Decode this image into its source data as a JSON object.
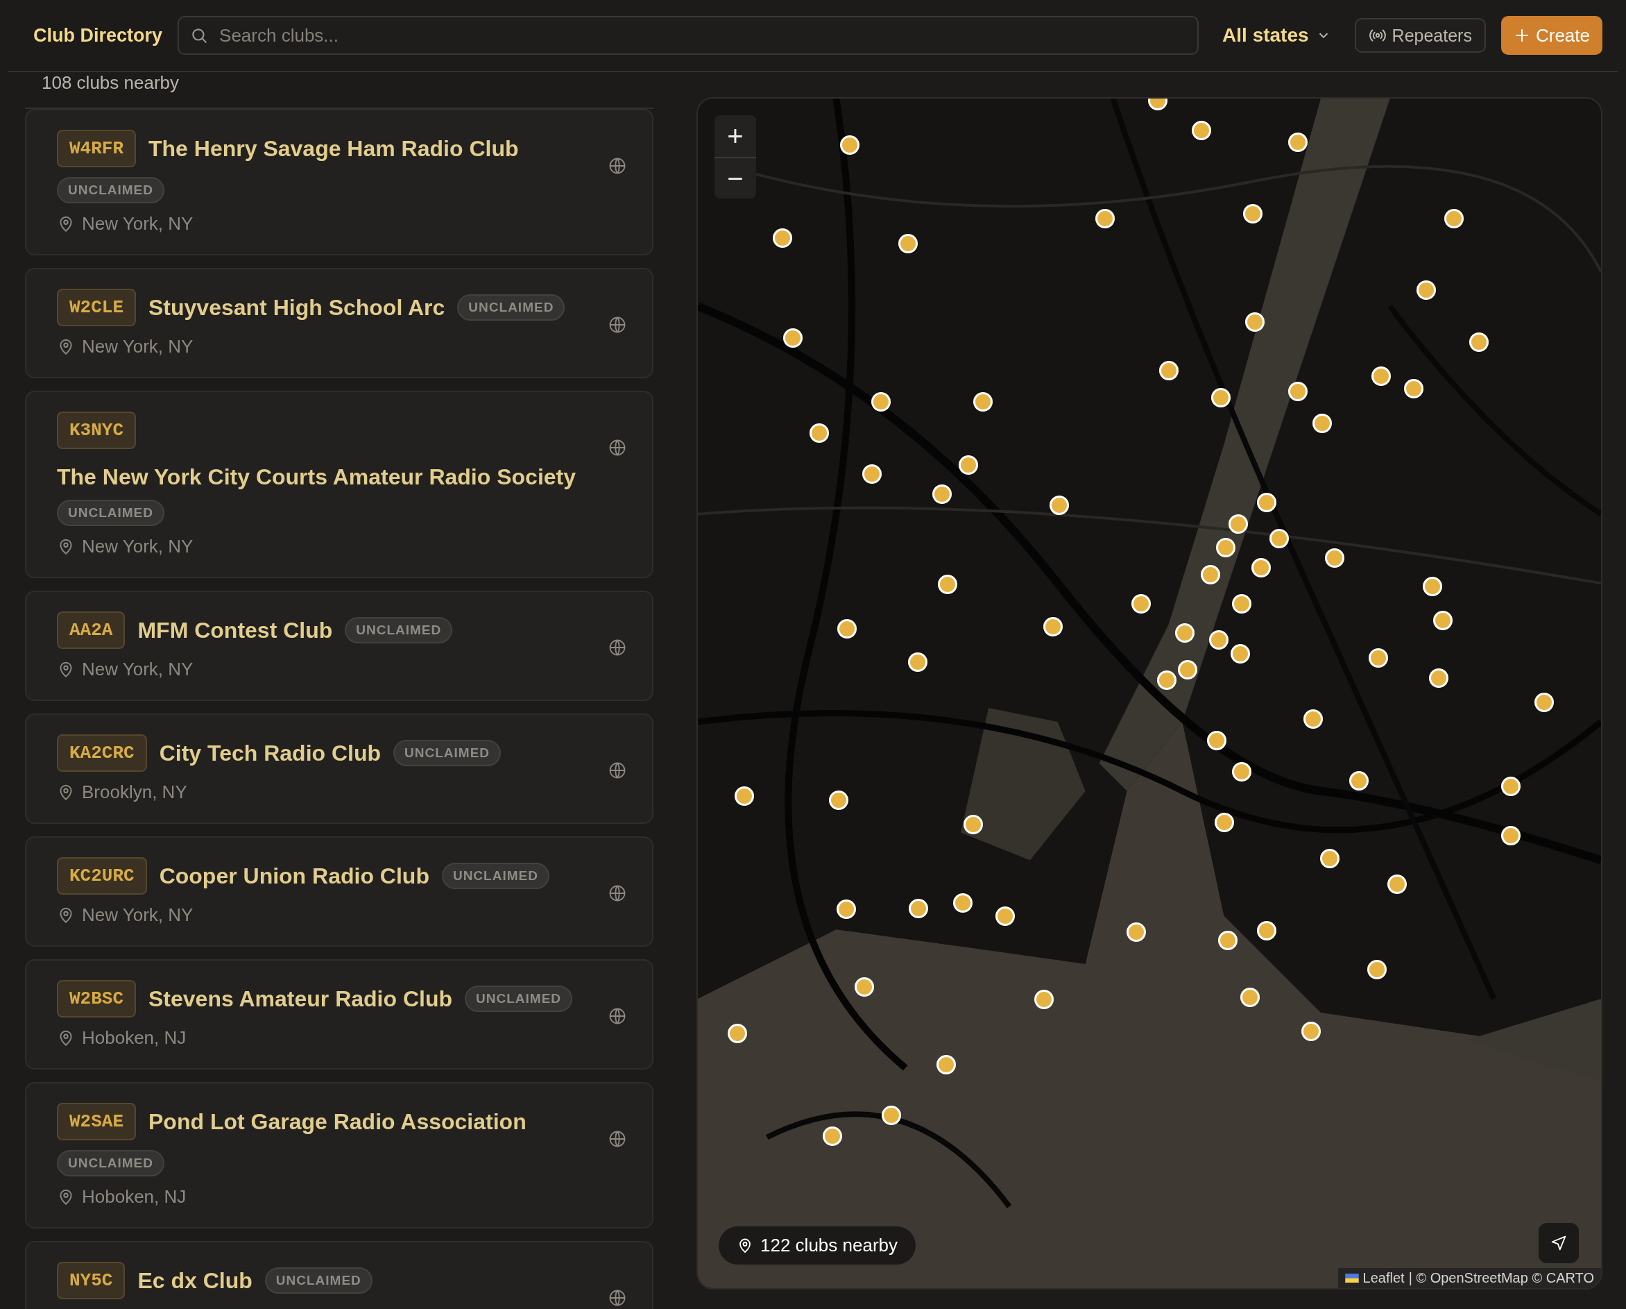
{
  "header": {
    "title": "Club Directory",
    "search": {
      "placeholder": "Search clubs..."
    },
    "state_filter": "All states",
    "repeaters_button": "Repeaters",
    "create_button": "Create"
  },
  "list": {
    "count": "108 clubs nearby",
    "clubs": [
      {
        "callsign": "W4RFR",
        "name": "The Henry Savage Ham Radio Club",
        "status": "UNCLAIMED",
        "location": "New York, NY",
        "kind": "stacked"
      },
      {
        "callsign": "W2CLE",
        "name": "Stuyvesant High School Arc",
        "status": "UNCLAIMED",
        "location": "New York, NY",
        "kind": "inline"
      },
      {
        "callsign": "K3NYC",
        "name": "The New York City Courts Amateur Radio Society",
        "status": "UNCLAIMED",
        "location": "New York, NY",
        "kind": "wide"
      },
      {
        "callsign": "AA2A",
        "name": "MFM Contest Club",
        "status": "UNCLAIMED",
        "location": "New York, NY",
        "kind": "inline"
      },
      {
        "callsign": "KA2CRC",
        "name": "City Tech Radio Club",
        "status": "UNCLAIMED",
        "location": "Brooklyn, NY",
        "kind": "inline"
      },
      {
        "callsign": "KC2URC",
        "name": "Cooper Union Radio Club",
        "status": "UNCLAIMED",
        "location": "New York, NY",
        "kind": "inline"
      },
      {
        "callsign": "W2BSC",
        "name": "Stevens Amateur Radio Club",
        "status": "UNCLAIMED",
        "location": "Hoboken, NJ",
        "kind": "inline"
      },
      {
        "callsign": "W2SAE",
        "name": "Pond Lot Garage Radio Association",
        "status": "UNCLAIMED",
        "location": "Hoboken, NJ",
        "kind": "stacked"
      },
      {
        "callsign": "NY5C",
        "name": "Ec dx Club",
        "status": "UNCLAIMED",
        "kind": "inline"
      }
    ]
  },
  "map": {
    "zoom_in": "+",
    "zoom_out": "−",
    "nearby": "122 clubs nearby",
    "attribution_link": "Leaflet",
    "attribution": "| © OpenStreetMap © CARTO"
  }
}
